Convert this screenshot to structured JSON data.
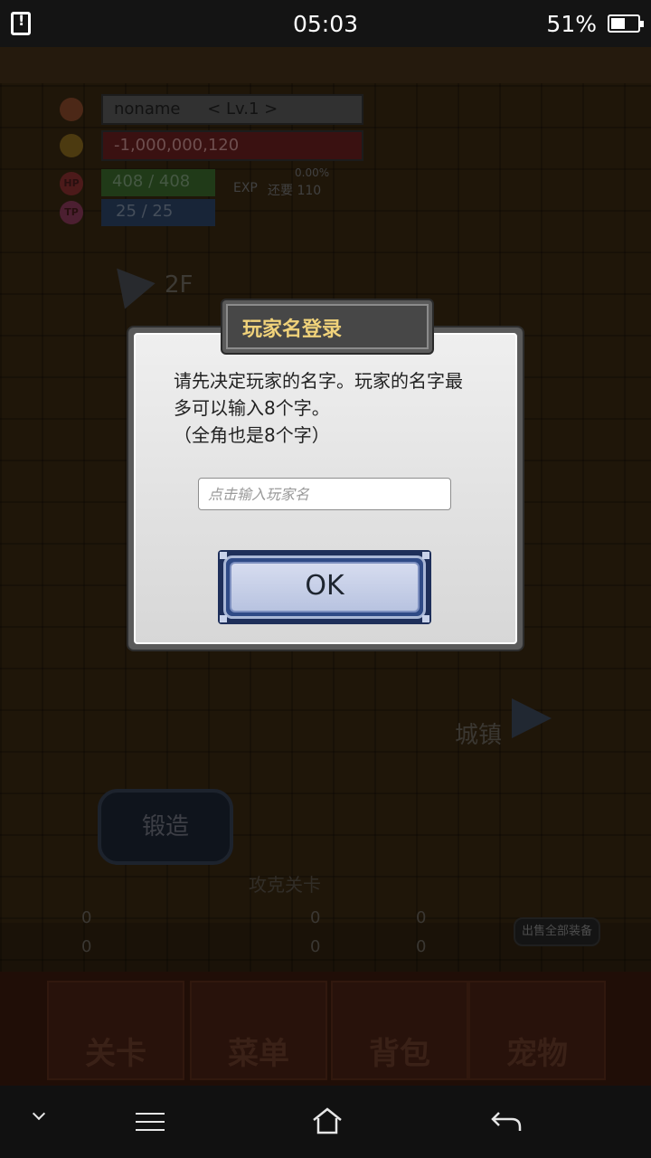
{
  "status_bar": {
    "time": "05:03",
    "battery_percent": "51%"
  },
  "hud": {
    "player_name": "noname",
    "level": "< Lv.1 >",
    "gold": "-1,000,000,120",
    "hp": "408 / 408",
    "tp": "25 / 25",
    "hp_icon_label": "HP",
    "tp_icon_label": "TP",
    "exp_label": "EXP",
    "exp_value": "0.00%",
    "exp_remaining": "还要 110"
  },
  "game": {
    "floor_label": "2F",
    "town_label": "城镇",
    "forge_label": "锻造",
    "conquer_label": "攻克关卡",
    "sell_all_label": "出售全部装备",
    "resources": [
      "0",
      "0",
      "0",
      "0",
      "0",
      "0"
    ],
    "tabs": [
      "关卡",
      "菜单",
      "背包",
      "宠物"
    ]
  },
  "dialog": {
    "title": "玩家名登录",
    "message_line1": "请先决定玩家的名字。玩家的名字最",
    "message_line2": "多可以输入8个字。",
    "message_line3": "（全角也是8个字）",
    "input_placeholder": "点击输入玩家名",
    "ok_label": "OK"
  },
  "icons": {
    "nav_down": "chevron-down-icon",
    "nav_menu": "menu-icon",
    "nav_home": "home-icon",
    "nav_back": "back-icon"
  }
}
